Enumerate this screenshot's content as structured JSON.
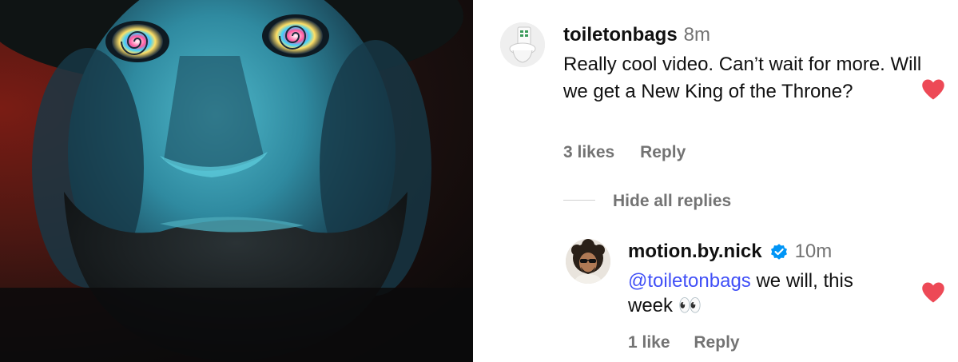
{
  "video": {
    "description_icon": "video-frame-icon"
  },
  "comments": [
    {
      "username": "toiletonbags",
      "time": "8m",
      "text": "Really cool video. Can’t wait for more. Will we get a New King of the Throne?",
      "likes": "3 likes",
      "reply_label": "Reply",
      "liked": true
    }
  ],
  "replies_toggle": "Hide all replies",
  "reply": {
    "username": "motion.by.nick",
    "verified": true,
    "time": "10m",
    "mention": "@toiletonbags",
    "text": " we will, this week 👀",
    "likes": "1 like",
    "reply_label": "Reply",
    "liked": true
  },
  "colors": {
    "heart": "#ed4956",
    "mention": "#4150f7",
    "muted": "#737373",
    "verified": "#0095f6"
  }
}
